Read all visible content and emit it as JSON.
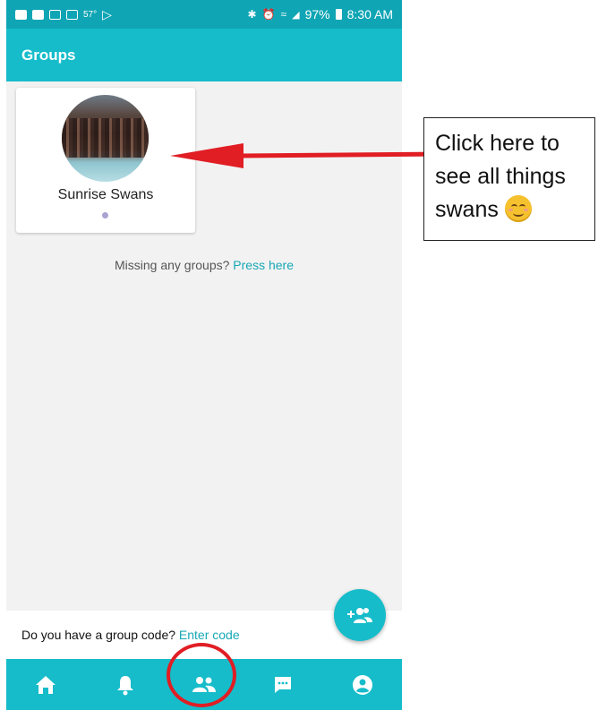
{
  "status_bar": {
    "temperature": "57°",
    "battery": "97%",
    "time": "8:30 AM"
  },
  "header": {
    "title": "Groups"
  },
  "groups": [
    {
      "name": "Sunrise Swans"
    }
  ],
  "missing": {
    "text": "Missing any groups?",
    "link": "Press here"
  },
  "code": {
    "text": "Do you have a group code?",
    "link": "Enter code"
  },
  "callout": {
    "line1": "Click here to",
    "line2": "see all things",
    "line3": "swans"
  },
  "colors": {
    "header": "#16bcca",
    "status_bar": "#0fa5b4",
    "link": "#17a8b6",
    "annotation_red": "#e01e24"
  },
  "bottom_nav": [
    "home-icon",
    "bell-icon",
    "groups-icon",
    "chat-icon",
    "account-icon"
  ]
}
